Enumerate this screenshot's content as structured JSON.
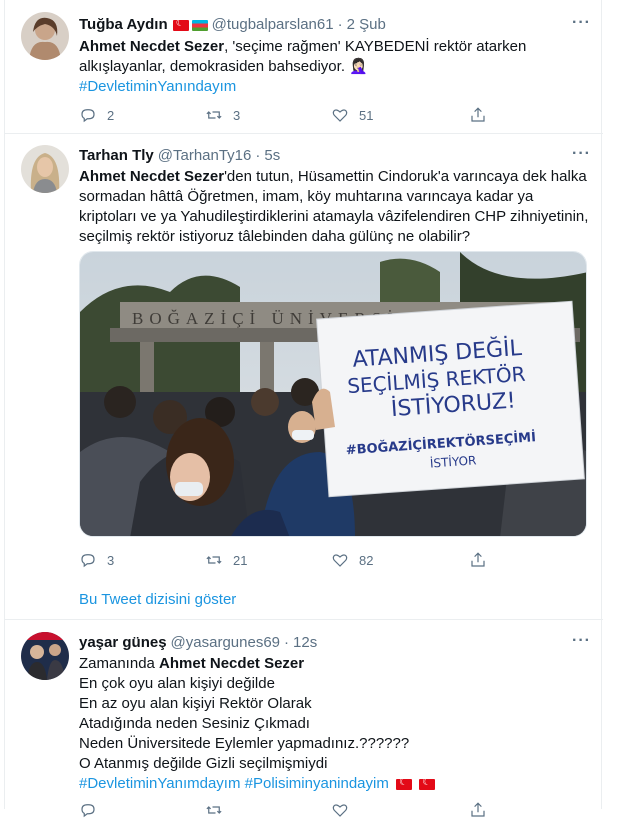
{
  "tweets": [
    {
      "name": "Tuğba Aydın",
      "handle": "@tugbalparslan61",
      "time": "2 Şub",
      "text_bold": "Ahmet Necdet Sezer",
      "text_rest": ", 'seçime rağmen' KAYBEDENİ rektör atarken alkışlayanlar, demokrasiden bahsediyor. 🤦🏻‍♀️",
      "hashtag": "#DevletiminYanındayım",
      "replies": "2",
      "retweets": "3",
      "likes": "51"
    },
    {
      "name": "Tarhan Tly",
      "handle": "@TarhanTy16",
      "time": "5s",
      "text_bold": "Ahmet Necdet Sezer",
      "text_rest": "'den tutun, Hüsamettin Cindoruk'a varıncaya dek halka sormadan hâttâ Öğretmen, imam, köy muhtarına varıncaya kadar ya kriptoları ve ya Yahudileştirdiklerini atamayla vâzifelendiren CHP zihniyetinin, seçilmiş rektör istiyoruz tâlebinden daha gülünç ne olabilir?",
      "image": {
        "gate_text": "BOĞAZİÇİ ÜNİVERSİTESİ",
        "sign_line1": "ATANMIŞ DEĞİL",
        "sign_line2": "SEÇİLMİŞ REKTÖR",
        "sign_line3": "İSTİYORUZ!",
        "sign_line4": "#BOĞAZİÇİREKTÖRSEÇİMİ",
        "sign_line5": "İSTİYOR"
      },
      "replies": "3",
      "retweets": "21",
      "likes": "82",
      "thread_link": "Bu Tweet dizisini göster"
    },
    {
      "name": "yaşar güneş",
      "handle": "@yasargunes69",
      "time": "12s",
      "line1_prefix": "Zamanında ",
      "line1_bold": "Ahmet Necdet Sezer",
      "line2": "En çok oyu alan kişiyi değilde",
      "line3": "En az oyu alan kişiyi Rektör Olarak",
      "line4": "Atadığında neden Sesiniz Çıkmadı",
      "line5": "Neden Üniversitede Eylemler yapmadınız.??????",
      "line6": "O Atanmış değilde Gizli seçilmişmiydi",
      "hashtag1": "#DevletiminYanımdayım",
      "hashtag2": "#Polisiminyanindayim"
    }
  ],
  "sep": "·",
  "more": "···",
  "icons": {
    "reply": "reply-icon",
    "retweet": "retweet-icon",
    "like": "like-icon",
    "share": "share-icon"
  },
  "colors": {
    "link": "#1b95e0",
    "secondary": "#5b7083",
    "border": "#ebeef0"
  }
}
